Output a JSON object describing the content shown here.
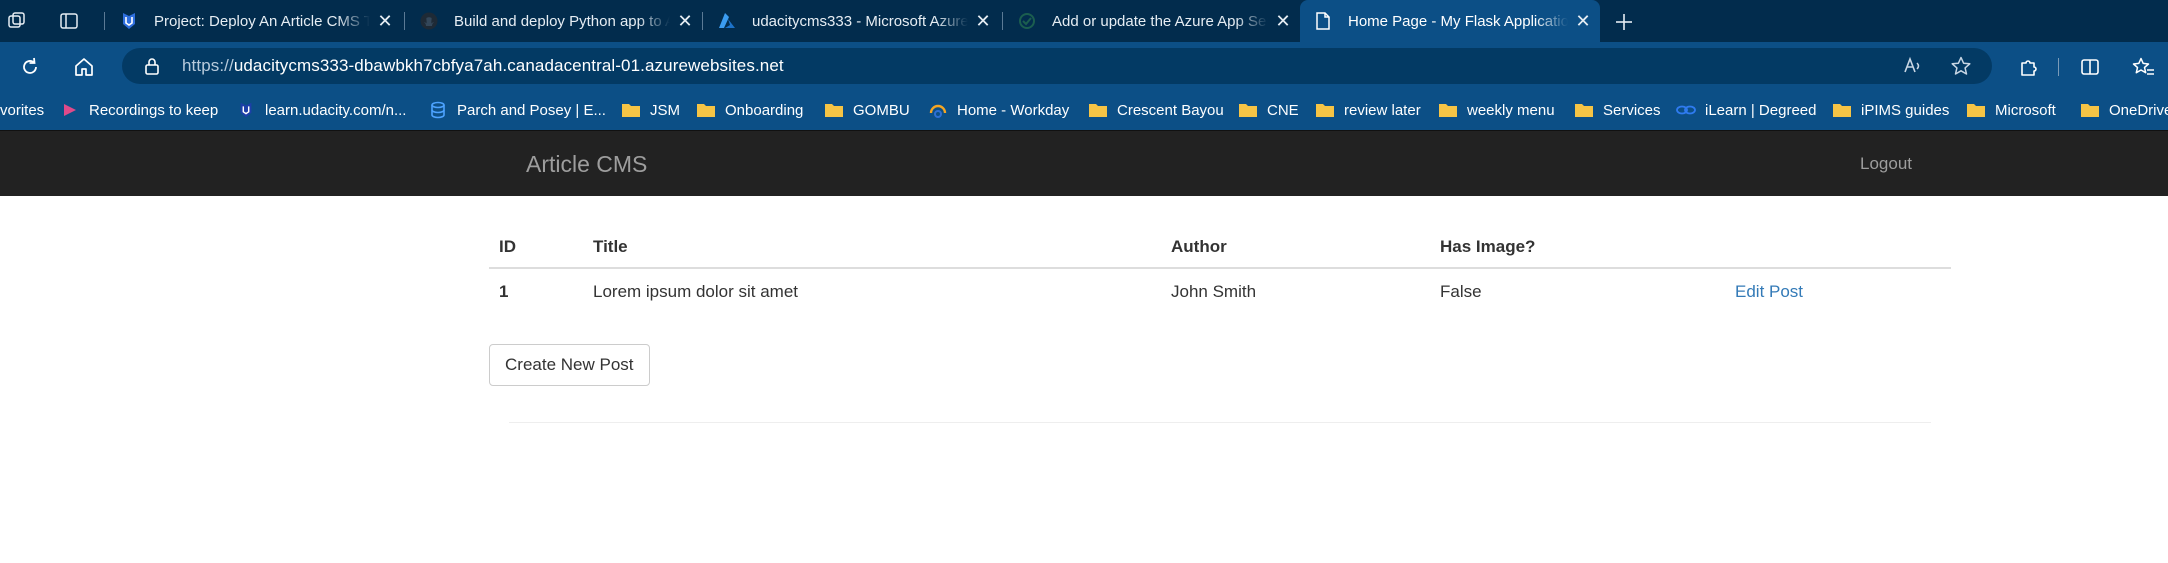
{
  "browser": {
    "tabs": [
      {
        "title": "Project: Deploy An Article CMS To Azure",
        "icon": "udacity-icon",
        "active": false
      },
      {
        "title": "Build and deploy Python app to Azure",
        "icon": "github-icon",
        "active": false
      },
      {
        "title": "udacitycms333 - Microsoft Azure",
        "icon": "azure-icon",
        "active": false
      },
      {
        "title": "Add or update the Azure App Service",
        "icon": "docs-icon",
        "active": false
      },
      {
        "title": "Home Page - My Flask Application",
        "icon": "page-icon",
        "active": true
      }
    ],
    "address": {
      "scheme": "https://",
      "host_and_path": "udacitycms333-dbawbkh7cbfya7ah.canadacentral-01.azurewebsites.net"
    },
    "favorites": [
      {
        "label": "vorites",
        "icon": "none"
      },
      {
        "label": "Recordings to keep",
        "icon": "stream-icon"
      },
      {
        "label": "learn.udacity.com/n...",
        "icon": "udacity-icon"
      },
      {
        "label": "Parch and Posey | E...",
        "icon": "database-icon"
      },
      {
        "label": "JSM",
        "icon": "folder-icon"
      },
      {
        "label": "Onboarding",
        "icon": "folder-icon"
      },
      {
        "label": "GOMBU",
        "icon": "folder-icon"
      },
      {
        "label": "Home - Workday",
        "icon": "workday-icon"
      },
      {
        "label": "Crescent Bayou",
        "icon": "folder-icon"
      },
      {
        "label": "CNE",
        "icon": "folder-icon"
      },
      {
        "label": "review later",
        "icon": "folder-icon"
      },
      {
        "label": "weekly menu",
        "icon": "folder-icon"
      },
      {
        "label": "Services",
        "icon": "folder-icon"
      },
      {
        "label": "iLearn | Degreed",
        "icon": "degreed-icon"
      },
      {
        "label": "iPIMS guides",
        "icon": "folder-icon"
      },
      {
        "label": "Microsoft",
        "icon": "folder-icon"
      },
      {
        "label": "OneDrive",
        "icon": "folder-icon"
      }
    ],
    "colors": {
      "tabstrip": "#022c4d",
      "toolbar": "#0c4f86",
      "folder": "#f6c445"
    }
  },
  "site": {
    "brand": "Article CMS",
    "logout": "Logout",
    "table": {
      "headers": [
        "ID",
        "Title",
        "Author",
        "Has Image?",
        ""
      ],
      "rows": [
        {
          "id": "1",
          "title": "Lorem ipsum dolor sit amet",
          "author": "John Smith",
          "has_image": "False",
          "action": "Edit Post"
        }
      ]
    },
    "create_button": "Create New Post",
    "colors": {
      "navbar": "#222222",
      "nav_text": "#9d9d9d",
      "link": "#337ab7"
    }
  }
}
